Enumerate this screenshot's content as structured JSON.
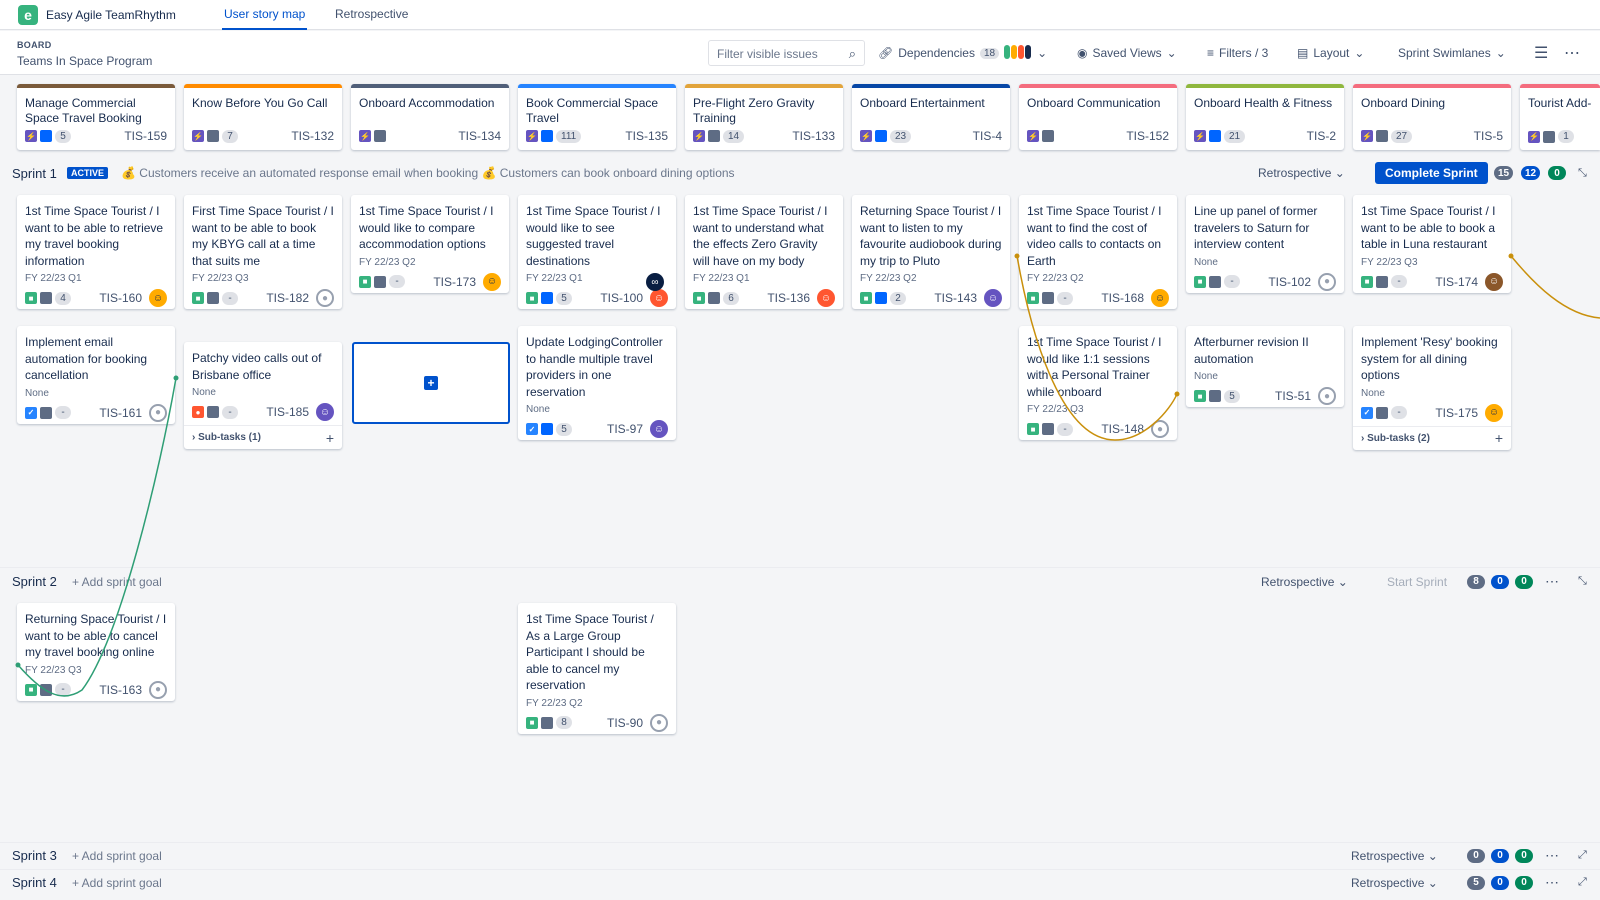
{
  "app": {
    "name": "Easy Agile TeamRhythm",
    "tabs": [
      "User story map",
      "Retrospective"
    ]
  },
  "header": {
    "board_label": "BOARD",
    "board_name": "Teams In Space Program",
    "filter_placeholder": "Filter visible issues",
    "dependencies_label": "Dependencies",
    "dependencies_count": "18",
    "saved_views": "Saved Views",
    "filters": "Filters / 3",
    "layout": "Layout",
    "swimlanes": "Sprint Swimlanes"
  },
  "colors": {
    "accent": "#0052cc",
    "green": "#00875a",
    "dep_green": "#2e9e75",
    "dep_orange": "#c9900c"
  },
  "epics": [
    {
      "title": "Manage Commercial Space Travel Booking",
      "count": "5",
      "key": "TIS-159",
      "color": "#7a5a3a"
    },
    {
      "title": "Know Before You Go Call",
      "count": "7",
      "key": "TIS-132",
      "color": "#ff8b00"
    },
    {
      "title": "Onboard Accommodation",
      "count": "",
      "key": "TIS-134",
      "color": "#505f79"
    },
    {
      "title": "Book Commercial Space Travel",
      "count": "111",
      "key": "TIS-135",
      "color": "#2684ff"
    },
    {
      "title": "Pre-Flight Zero Gravity Training",
      "count": "14",
      "key": "TIS-133",
      "color": "#e2a43b"
    },
    {
      "title": "Onboard Entertainment",
      "count": "23",
      "key": "TIS-4",
      "color": "#0747a6"
    },
    {
      "title": "Onboard Communication",
      "count": "",
      "key": "TIS-152",
      "color": "#f46c7e"
    },
    {
      "title": "Onboard Health & Fitness",
      "count": "21",
      "key": "TIS-2",
      "color": "#8fb73e"
    },
    {
      "title": "Onboard Dining",
      "count": "27",
      "key": "TIS-5",
      "color": "#f46c7e"
    },
    {
      "title": "Tourist Add-On Trips",
      "count": "1",
      "key": "",
      "color": "#f46c7e"
    }
  ],
  "sprints": [
    {
      "name": "Sprint 1",
      "badge": "ACTIVE",
      "goal": "💰 Customers receive an automated response email when booking 💰 Customers can book onboard dining options",
      "retro": "Retrospective",
      "action": "Complete Sprint",
      "counts": [
        "15",
        "12",
        "0"
      ]
    },
    {
      "name": "Sprint 2",
      "goal": "+ Add sprint goal",
      "retro": "Retrospective",
      "action": "Start Sprint",
      "counts": [
        "8",
        "0",
        "0"
      ]
    },
    {
      "name": "Sprint 3",
      "goal": "+ Add sprint goal",
      "retro": "Retrospective",
      "counts": [
        "0",
        "0",
        "0"
      ]
    },
    {
      "name": "Sprint 4",
      "goal": "+ Add sprint goal",
      "retro": "Retrospective",
      "counts": [
        "5",
        "0",
        "0"
      ]
    }
  ],
  "cards": {
    "c1": {
      "title": "1st Time Space Tourist / I want to be able to retrieve my travel booking information",
      "sub": "FY 22/23 Q1",
      "est": "4",
      "key": "TIS-160"
    },
    "c2": {
      "title": "First Time Space Tourist / I want to be able to book my KBYG call at a time that suits me",
      "sub": "FY 22/23 Q3",
      "est": "-",
      "key": "TIS-182"
    },
    "c3": {
      "title": "1st Time Space Tourist / I would like to compare accommodation options",
      "sub": "FY 22/23 Q2",
      "est": "-",
      "key": "TIS-173"
    },
    "c4": {
      "title": "1st Time Space Tourist / I would like to see suggested travel destinations",
      "sub": "FY 22/23 Q1",
      "est": "5",
      "key": "TIS-100"
    },
    "c5": {
      "title": "1st Time Space Tourist / I want to understand what the effects Zero Gravity will have on my body",
      "sub": "FY 22/23 Q1",
      "est": "6",
      "key": "TIS-136"
    },
    "c6": {
      "title": "Returning Space Tourist / I want to listen to my favourite audiobook during my trip to Pluto",
      "sub": "FY 22/23 Q2",
      "est": "2",
      "key": "TIS-143"
    },
    "c7": {
      "title": "1st Time Space Tourist / I want to find the cost of video calls to contacts on Earth",
      "sub": "FY 22/23 Q2",
      "est": "-",
      "key": "TIS-168"
    },
    "c8": {
      "title": "Line up panel of former travelers to Saturn for interview content",
      "sub": "None",
      "est": "-",
      "key": "TIS-102"
    },
    "c9": {
      "title": "1st Time Space Tourist / I want to be able to book a table in Luna restaurant",
      "sub": "FY 22/23 Q3",
      "est": "-",
      "key": "TIS-174"
    },
    "c10": {
      "title": "Implement email automation for booking cancellation",
      "sub": "None",
      "est": "-",
      "key": "TIS-161"
    },
    "c11": {
      "title": "Patchy video calls out of Brisbane office",
      "sub": "None",
      "est": "-",
      "key": "TIS-185",
      "subtasks": "Sub-tasks (1)"
    },
    "c12": {
      "title": "Update LodgingController to handle multiple travel providers in one reservation",
      "sub": "None",
      "est": "5",
      "key": "TIS-97"
    },
    "c13": {
      "title": "1st Time Space Tourist / I would like 1:1 sessions with a Personal Trainer while onboard",
      "sub": "FY 22/23 Q3",
      "est": "-",
      "key": "TIS-148"
    },
    "c14": {
      "title": "Afterburner revision II automation",
      "sub": "None",
      "est": "5",
      "key": "TIS-51"
    },
    "c15": {
      "title": "Implement 'Resy' booking system for all dining options",
      "sub": "None",
      "est": "-",
      "key": "TIS-175",
      "subtasks": "Sub-tasks (2)"
    },
    "c16": {
      "title": "Returning Space Tourist / I want to be able to cancel my travel booking online",
      "sub": "FY 22/23 Q3",
      "est": "-",
      "key": "TIS-163"
    },
    "c17": {
      "title": "1st Time Space Tourist / As a Large Group Participant I should be able to cancel my reservation",
      "sub": "FY 22/23 Q2",
      "est": "8",
      "key": "TIS-90"
    }
  }
}
